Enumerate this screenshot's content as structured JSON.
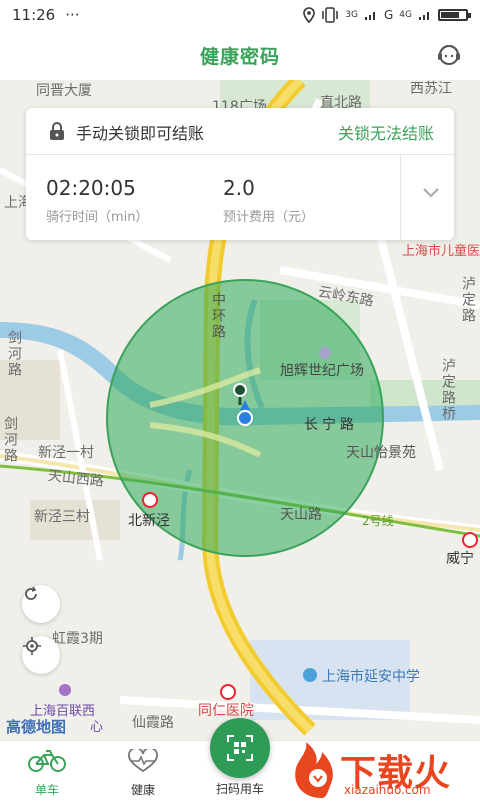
{
  "status_bar": {
    "time": "11:26",
    "dots": "···",
    "net1": "3G",
    "net2": "G",
    "carrier": "4G"
  },
  "header": {
    "title": "健康密码",
    "service_icon": "customer-service-icon"
  },
  "card": {
    "lock_hint": "手动关锁即可结账",
    "lock_issue_link": "关锁无法结账",
    "ride_time": {
      "value": "02:20:05",
      "label": "骑行时间（min）"
    },
    "cost": {
      "value": "2.0",
      "label": "预计费用（元）"
    }
  },
  "map": {
    "labels": {
      "road_zhonghuan": "中环路",
      "road_yunling_east": "云岭东路",
      "xuhui_plaza": "旭辉世纪广场",
      "road_changning": "长宁路",
      "road_luding": "泸定路",
      "road_luding_bridge": "泸定路桥",
      "road_jianhe": "剑河路",
      "xinjing_village1": "新泾一村",
      "road_tianshan_west": "天山西路",
      "tianshan_yijing": "天山怡景苑",
      "xinjing_village3": "新泾三村",
      "beixinjing": "北新泾",
      "road_tianshan": "天山路",
      "line2": "2号线",
      "weining": "威宁",
      "hongzhen": "虹霞3期",
      "yanan_school": "上海市延安中学",
      "tongren": "同仁医院",
      "xiantao": "仙霞路",
      "bailian": "上海百联西",
      "bailian2": "心",
      "zhibei": "直北路",
      "square118": "118广场",
      "tongxiang": "同晋大厦",
      "children_hospital": "上海市儿童医",
      "shanghai_partial": "上海",
      "xisujiang": "西苏江"
    },
    "logo": "高德地图"
  },
  "tabs": [
    {
      "label": "单车",
      "icon": "bike-icon",
      "active": true
    },
    {
      "label": "健康",
      "icon": "heart-pulse-icon",
      "active": false
    }
  ],
  "scan": {
    "label": "扫码用车",
    "icon": "qr-scan-icon"
  },
  "watermark": {
    "text": "下载火",
    "url": "xiazaihuo.com"
  },
  "colors": {
    "accent": "#3aa35a",
    "scan": "#2e9c56",
    "watermark": "#e8461f"
  }
}
